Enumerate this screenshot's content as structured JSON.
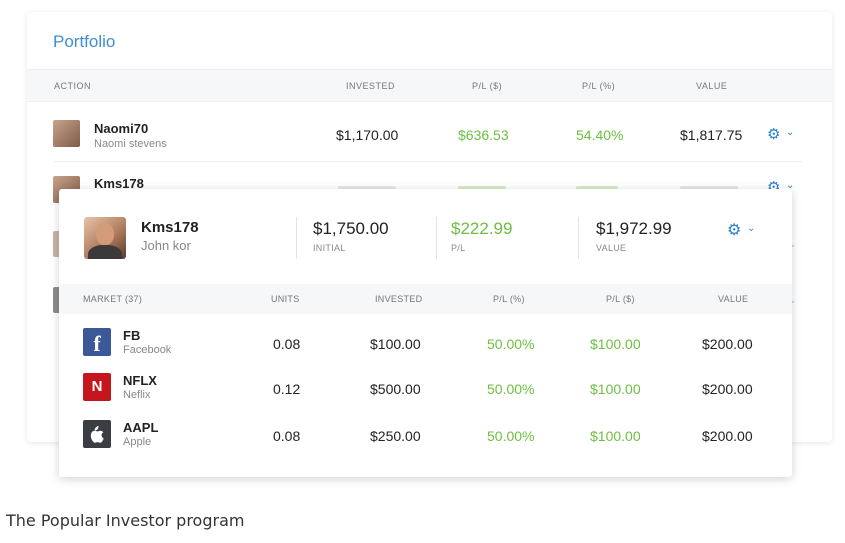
{
  "portfolio": {
    "title": "Portfolio",
    "columns": [
      "ACTION",
      "INVESTED",
      "P/L ($)",
      "P/L (%)",
      "VALUE"
    ],
    "rows": [
      {
        "username": "Naomi70",
        "name": "Naomi stevens",
        "invested": "$1,170.00",
        "pl_usd": "$636.53",
        "pl_pct": "54.40%",
        "value": "$1,817.75"
      },
      {
        "username": "Kms178"
      }
    ]
  },
  "detail": {
    "username": "Kms178",
    "name": "John kor",
    "stats": [
      {
        "value": "$1,750.00",
        "label": "INITIAL",
        "color": "#222222"
      },
      {
        "value": "$222.99",
        "label": "P/L",
        "color": "#6dbf3f"
      },
      {
        "value": "$1,972.99",
        "label": "VALUE",
        "color": "#222222"
      }
    ],
    "columns": [
      "MARKET (37)",
      "UNITS",
      "INVESTED",
      "P/L (%)",
      "P/L ($)",
      "VALUE"
    ],
    "markets": [
      {
        "ticker": "FB",
        "company": "Facebook",
        "icon": "facebook-icon",
        "icon_glyph": "f",
        "icon_color": "#3b5998",
        "units": "0.08",
        "invested": "$100.00",
        "pl_pct": "50.00%",
        "pl_usd": "$100.00",
        "value": "$200.00"
      },
      {
        "ticker": "NFLX",
        "company": "Neflix",
        "icon": "netflix-icon",
        "icon_glyph": "N",
        "icon_color": "#c4161c",
        "units": "0.12",
        "invested": "$500.00",
        "pl_pct": "50.00%",
        "pl_usd": "$100.00",
        "value": "$200.00"
      },
      {
        "ticker": "AAPL",
        "company": "Apple",
        "icon": "apple-icon",
        "icon_glyph": "",
        "icon_color": "#3a3d42",
        "units": "0.08",
        "invested": "$250.00",
        "pl_pct": "50.00%",
        "pl_usd": "$100.00",
        "value": "$200.00"
      }
    ]
  },
  "caption": "The Popular Investor program",
  "colors": {
    "accent": "#3d8fd6",
    "gain": "#6dbf3f",
    "gear": "#2c7fd0"
  }
}
